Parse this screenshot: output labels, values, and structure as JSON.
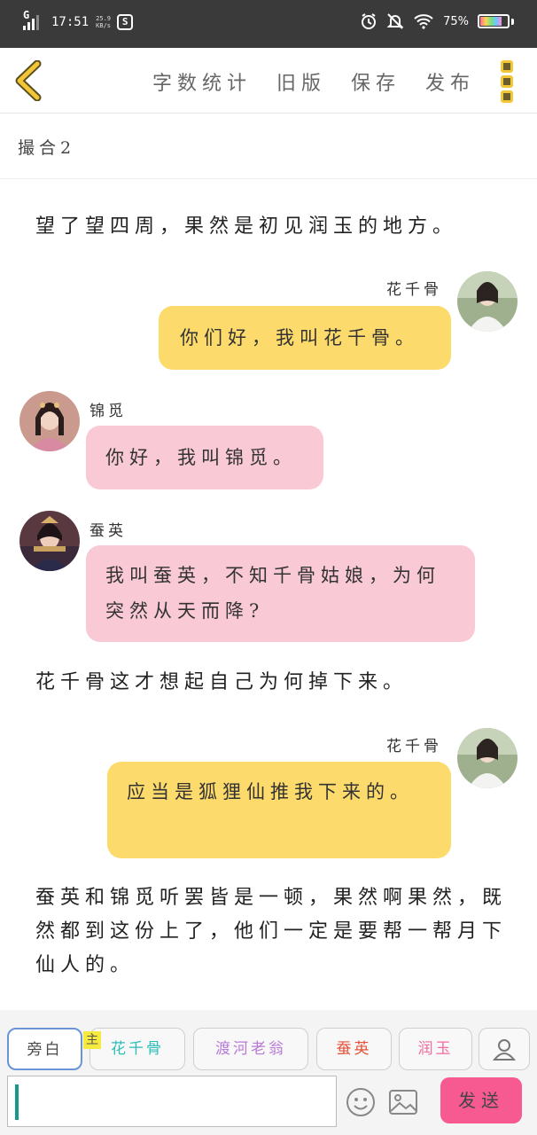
{
  "status_bar": {
    "signal_label": "G",
    "time": "17:51",
    "net_speed": "25.9 KB/s",
    "app_badge": "S",
    "battery": "75%",
    "battery_level": 0.75
  },
  "toolbar": {
    "actions": [
      "字数统计",
      "旧版",
      "保存",
      "发布"
    ]
  },
  "chapter_title": "撮合2",
  "content": {
    "narr1": "望了望四周，果然是初见润玉的地方。",
    "msg1": {
      "name": "花千骨",
      "text": "你们好，我叫花千骨。"
    },
    "msg2": {
      "name": "锦觅",
      "text": "你好，我叫锦觅。"
    },
    "msg3": {
      "name": "蚕英",
      "text": "我叫蚕英，不知千骨姑娘，为何突然从天而降?"
    },
    "narr2": "花千骨这才想起自己为何掉下来。",
    "msg4": {
      "name": "花千骨",
      "text": "应当是狐狸仙推我下来的。"
    },
    "narr3": "蚕英和锦觅听罢皆是一顿，果然啊果然，既然都到这份上了，他们一定是要帮一帮月下仙人的。"
  },
  "bottom": {
    "chips": [
      {
        "label": "旁白",
        "color": "#4a4a4a"
      },
      {
        "label": "花千骨",
        "color": "#2bbdb8"
      },
      {
        "label": "渡河老翁",
        "color": "#b97ad6"
      },
      {
        "label": "蚕英",
        "color": "#e2533a"
      },
      {
        "label": "润玉",
        "color": "#f06ba0"
      }
    ],
    "main_tag": "主",
    "input_value": "",
    "send_label": "发送"
  },
  "colors": {
    "yellow_bubble": "#fcda6c",
    "pink_bubble": "#f9c9d6",
    "send_button": "#f65a91",
    "back_arrow": "#f2c636"
  },
  "icons": [
    "back-arrow-icon",
    "more-icon",
    "emoji-icon",
    "image-icon",
    "person-icon"
  ]
}
